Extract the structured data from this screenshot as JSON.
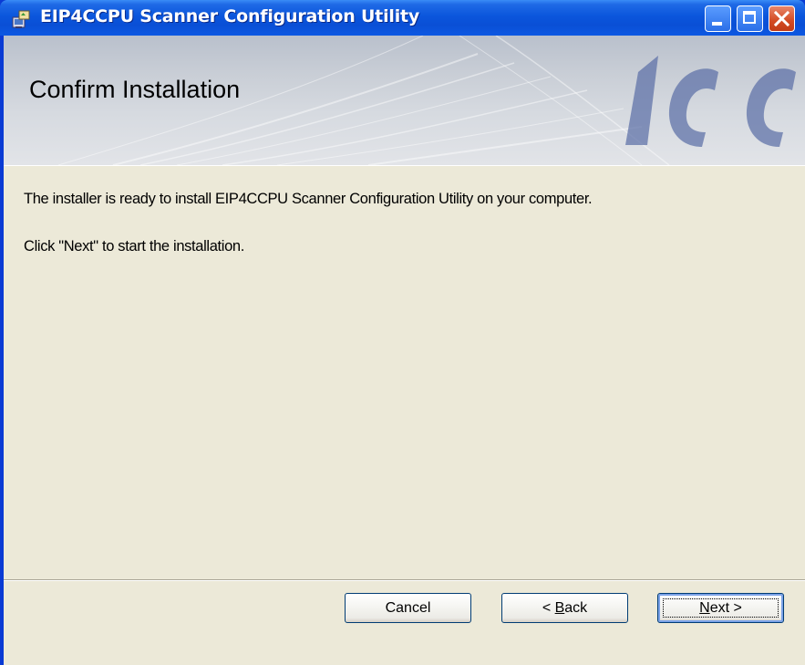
{
  "window": {
    "title": "EIP4CCPU Scanner Configuration Utility",
    "controls": {
      "minimize": "minimize-icon",
      "maximize": "maximize-icon",
      "close": "close-icon"
    }
  },
  "banner": {
    "title": "Confirm Installation",
    "logo_text": "ICC"
  },
  "body": {
    "line1": "The installer is ready to install EIP4CCPU Scanner Configuration Utility on your computer.",
    "line2": "Click \"Next\" to start the installation."
  },
  "buttons": {
    "cancel": "Cancel",
    "back_prefix": "< ",
    "back_mnemonic": "B",
    "back_rest": "ack",
    "next_mnemonic": "N",
    "next_rest": "ext >"
  },
  "colors": {
    "titlebar": "#0a4fd6",
    "dialog_bg": "#ece9d8",
    "close_button": "#d34a22",
    "logo": "#5b6fa6"
  }
}
